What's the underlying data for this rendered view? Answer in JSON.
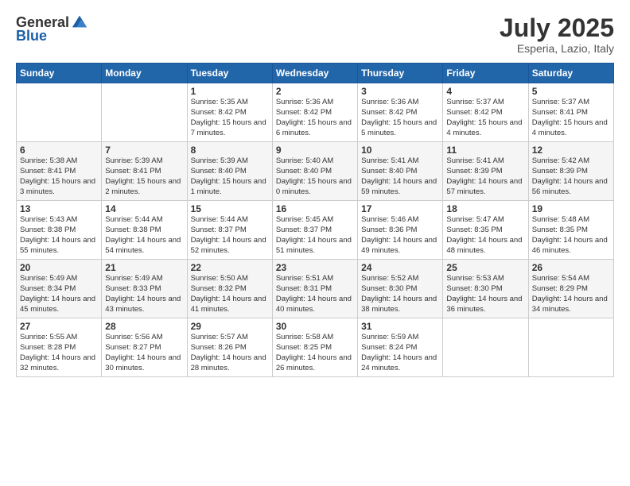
{
  "header": {
    "logo_line1": "General",
    "logo_line2": "Blue",
    "month": "July 2025",
    "location": "Esperia, Lazio, Italy"
  },
  "weekdays": [
    "Sunday",
    "Monday",
    "Tuesday",
    "Wednesday",
    "Thursday",
    "Friday",
    "Saturday"
  ],
  "weeks": [
    [
      {
        "day": "",
        "info": ""
      },
      {
        "day": "",
        "info": ""
      },
      {
        "day": "1",
        "info": "Sunrise: 5:35 AM\nSunset: 8:42 PM\nDaylight: 15 hours\nand 7 minutes."
      },
      {
        "day": "2",
        "info": "Sunrise: 5:36 AM\nSunset: 8:42 PM\nDaylight: 15 hours\nand 6 minutes."
      },
      {
        "day": "3",
        "info": "Sunrise: 5:36 AM\nSunset: 8:42 PM\nDaylight: 15 hours\nand 5 minutes."
      },
      {
        "day": "4",
        "info": "Sunrise: 5:37 AM\nSunset: 8:42 PM\nDaylight: 15 hours\nand 4 minutes."
      },
      {
        "day": "5",
        "info": "Sunrise: 5:37 AM\nSunset: 8:41 PM\nDaylight: 15 hours\nand 4 minutes."
      }
    ],
    [
      {
        "day": "6",
        "info": "Sunrise: 5:38 AM\nSunset: 8:41 PM\nDaylight: 15 hours\nand 3 minutes."
      },
      {
        "day": "7",
        "info": "Sunrise: 5:39 AM\nSunset: 8:41 PM\nDaylight: 15 hours\nand 2 minutes."
      },
      {
        "day": "8",
        "info": "Sunrise: 5:39 AM\nSunset: 8:40 PM\nDaylight: 15 hours\nand 1 minute."
      },
      {
        "day": "9",
        "info": "Sunrise: 5:40 AM\nSunset: 8:40 PM\nDaylight: 15 hours\nand 0 minutes."
      },
      {
        "day": "10",
        "info": "Sunrise: 5:41 AM\nSunset: 8:40 PM\nDaylight: 14 hours\nand 59 minutes."
      },
      {
        "day": "11",
        "info": "Sunrise: 5:41 AM\nSunset: 8:39 PM\nDaylight: 14 hours\nand 57 minutes."
      },
      {
        "day": "12",
        "info": "Sunrise: 5:42 AM\nSunset: 8:39 PM\nDaylight: 14 hours\nand 56 minutes."
      }
    ],
    [
      {
        "day": "13",
        "info": "Sunrise: 5:43 AM\nSunset: 8:38 PM\nDaylight: 14 hours\nand 55 minutes."
      },
      {
        "day": "14",
        "info": "Sunrise: 5:44 AM\nSunset: 8:38 PM\nDaylight: 14 hours\nand 54 minutes."
      },
      {
        "day": "15",
        "info": "Sunrise: 5:44 AM\nSunset: 8:37 PM\nDaylight: 14 hours\nand 52 minutes."
      },
      {
        "day": "16",
        "info": "Sunrise: 5:45 AM\nSunset: 8:37 PM\nDaylight: 14 hours\nand 51 minutes."
      },
      {
        "day": "17",
        "info": "Sunrise: 5:46 AM\nSunset: 8:36 PM\nDaylight: 14 hours\nand 49 minutes."
      },
      {
        "day": "18",
        "info": "Sunrise: 5:47 AM\nSunset: 8:35 PM\nDaylight: 14 hours\nand 48 minutes."
      },
      {
        "day": "19",
        "info": "Sunrise: 5:48 AM\nSunset: 8:35 PM\nDaylight: 14 hours\nand 46 minutes."
      }
    ],
    [
      {
        "day": "20",
        "info": "Sunrise: 5:49 AM\nSunset: 8:34 PM\nDaylight: 14 hours\nand 45 minutes."
      },
      {
        "day": "21",
        "info": "Sunrise: 5:49 AM\nSunset: 8:33 PM\nDaylight: 14 hours\nand 43 minutes."
      },
      {
        "day": "22",
        "info": "Sunrise: 5:50 AM\nSunset: 8:32 PM\nDaylight: 14 hours\nand 41 minutes."
      },
      {
        "day": "23",
        "info": "Sunrise: 5:51 AM\nSunset: 8:31 PM\nDaylight: 14 hours\nand 40 minutes."
      },
      {
        "day": "24",
        "info": "Sunrise: 5:52 AM\nSunset: 8:30 PM\nDaylight: 14 hours\nand 38 minutes."
      },
      {
        "day": "25",
        "info": "Sunrise: 5:53 AM\nSunset: 8:30 PM\nDaylight: 14 hours\nand 36 minutes."
      },
      {
        "day": "26",
        "info": "Sunrise: 5:54 AM\nSunset: 8:29 PM\nDaylight: 14 hours\nand 34 minutes."
      }
    ],
    [
      {
        "day": "27",
        "info": "Sunrise: 5:55 AM\nSunset: 8:28 PM\nDaylight: 14 hours\nand 32 minutes."
      },
      {
        "day": "28",
        "info": "Sunrise: 5:56 AM\nSunset: 8:27 PM\nDaylight: 14 hours\nand 30 minutes."
      },
      {
        "day": "29",
        "info": "Sunrise: 5:57 AM\nSunset: 8:26 PM\nDaylight: 14 hours\nand 28 minutes."
      },
      {
        "day": "30",
        "info": "Sunrise: 5:58 AM\nSunset: 8:25 PM\nDaylight: 14 hours\nand 26 minutes."
      },
      {
        "day": "31",
        "info": "Sunrise: 5:59 AM\nSunset: 8:24 PM\nDaylight: 14 hours\nand 24 minutes."
      },
      {
        "day": "",
        "info": ""
      },
      {
        "day": "",
        "info": ""
      }
    ]
  ]
}
